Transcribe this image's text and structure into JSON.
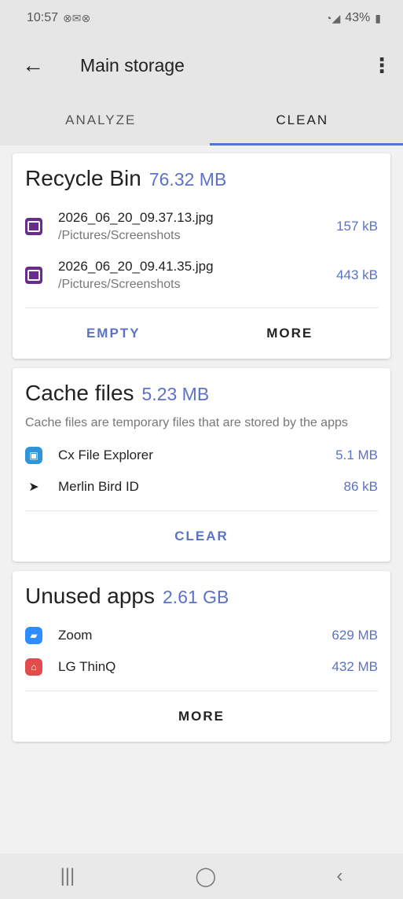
{
  "status": {
    "time": "10:57",
    "left_icons": "⊗✉⊗",
    "battery": "43%",
    "signal": "◔◢"
  },
  "app_bar": {
    "title": "Main storage"
  },
  "tabs": [
    {
      "label": "ANALYZE"
    },
    {
      "label": "CLEAN"
    }
  ],
  "recycle": {
    "title": "Recycle Bin",
    "size": "76.32 MB",
    "items": [
      {
        "name": "2026_06_20_09.37.13.jpg",
        "path": "/Pictures/Screenshots",
        "size": "157 kB"
      },
      {
        "name": "2026_06_20_09.41.35.jpg",
        "path": "/Pictures/Screenshots",
        "size": "443 kB"
      }
    ],
    "empty_label": "EMPTY",
    "more_label": "MORE"
  },
  "cache": {
    "title": "Cache files",
    "size": "5.23 MB",
    "description": "Cache files are temporary files that are stored by the apps",
    "items": [
      {
        "name": "Cx File Explorer",
        "size": "5.1 MB"
      },
      {
        "name": "Merlin Bird ID",
        "size": "86 kB"
      }
    ],
    "clear_label": "CLEAR"
  },
  "unused": {
    "title": "Unused apps",
    "size": "2.61 GB",
    "items": [
      {
        "name": "Zoom",
        "size": "629 MB"
      },
      {
        "name": "LG ThinQ",
        "size": "432 MB"
      }
    ],
    "more_label": "MORE"
  },
  "colors": {
    "accent": "#5b72c8",
    "tab_indicator": "#4a78d8"
  }
}
